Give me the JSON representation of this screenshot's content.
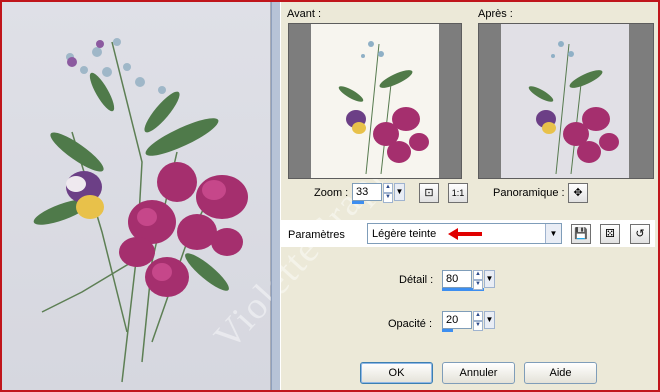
{
  "dialog": {
    "avant_label": "Avant :",
    "apres_label": "Après :",
    "zoom": {
      "label": "Zoom :",
      "value": "33",
      "level": 0.33
    },
    "panoramique_label": "Panoramique :",
    "fit_icon": "fit-to-window-icon",
    "actual_size_label": "1:1",
    "pan_icon": "move-icon",
    "parametres_label": "Paramètres",
    "preset_value": "Légère teinte",
    "save_preset_icon": "floppy-disk-icon",
    "random_icon": "dice-icon",
    "reset_icon": "reset-icon",
    "detail": {
      "label": "Détail :",
      "value": "80",
      "level": 0.8
    },
    "opacite": {
      "label": "Opacité :",
      "value": "20",
      "level": 0.2
    },
    "ok_label": "OK",
    "cancel_label": "Annuler",
    "help_label": "Aide",
    "watermark": "VioletteGraph",
    "arrow_color": "#e00000"
  }
}
